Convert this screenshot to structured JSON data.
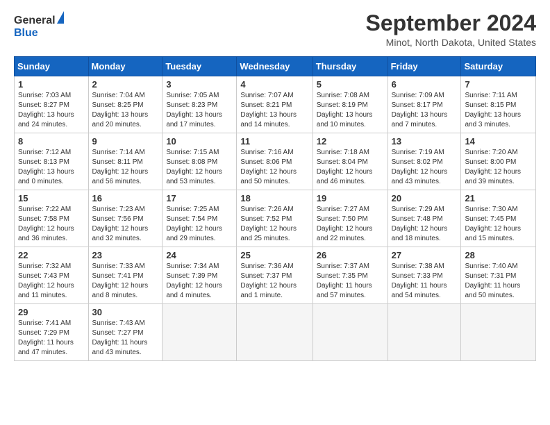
{
  "header": {
    "logo_general": "General",
    "logo_blue": "Blue",
    "month_title": "September 2024",
    "location": "Minot, North Dakota, United States"
  },
  "calendar": {
    "days_of_week": [
      "Sunday",
      "Monday",
      "Tuesday",
      "Wednesday",
      "Thursday",
      "Friday",
      "Saturday"
    ],
    "weeks": [
      [
        {
          "day": "",
          "empty": true
        },
        {
          "day": "",
          "empty": true
        },
        {
          "day": "",
          "empty": true
        },
        {
          "day": "",
          "empty": true
        },
        {
          "day": "",
          "empty": true
        },
        {
          "day": "",
          "empty": true
        },
        {
          "day": "",
          "empty": true
        }
      ]
    ]
  },
  "cells": {
    "empty": "",
    "w1": [
      {
        "num": "1",
        "sunrise": "Sunrise: 7:03 AM",
        "sunset": "Sunset: 8:27 PM",
        "daylight": "Daylight: 13 hours",
        "daylight2": "and 24 minutes."
      },
      {
        "num": "2",
        "sunrise": "Sunrise: 7:04 AM",
        "sunset": "Sunset: 8:25 PM",
        "daylight": "Daylight: 13 hours",
        "daylight2": "and 20 minutes."
      },
      {
        "num": "3",
        "sunrise": "Sunrise: 7:05 AM",
        "sunset": "Sunset: 8:23 PM",
        "daylight": "Daylight: 13 hours",
        "daylight2": "and 17 minutes."
      },
      {
        "num": "4",
        "sunrise": "Sunrise: 7:07 AM",
        "sunset": "Sunset: 8:21 PM",
        "daylight": "Daylight: 13 hours",
        "daylight2": "and 14 minutes."
      },
      {
        "num": "5",
        "sunrise": "Sunrise: 7:08 AM",
        "sunset": "Sunset: 8:19 PM",
        "daylight": "Daylight: 13 hours",
        "daylight2": "and 10 minutes."
      },
      {
        "num": "6",
        "sunrise": "Sunrise: 7:09 AM",
        "sunset": "Sunset: 8:17 PM",
        "daylight": "Daylight: 13 hours",
        "daylight2": "and 7 minutes."
      },
      {
        "num": "7",
        "sunrise": "Sunrise: 7:11 AM",
        "sunset": "Sunset: 8:15 PM",
        "daylight": "Daylight: 13 hours",
        "daylight2": "and 3 minutes."
      }
    ],
    "w2": [
      {
        "num": "8",
        "sunrise": "Sunrise: 7:12 AM",
        "sunset": "Sunset: 8:13 PM",
        "daylight": "Daylight: 13 hours",
        "daylight2": "and 0 minutes."
      },
      {
        "num": "9",
        "sunrise": "Sunrise: 7:14 AM",
        "sunset": "Sunset: 8:11 PM",
        "daylight": "Daylight: 12 hours",
        "daylight2": "and 56 minutes."
      },
      {
        "num": "10",
        "sunrise": "Sunrise: 7:15 AM",
        "sunset": "Sunset: 8:08 PM",
        "daylight": "Daylight: 12 hours",
        "daylight2": "and 53 minutes."
      },
      {
        "num": "11",
        "sunrise": "Sunrise: 7:16 AM",
        "sunset": "Sunset: 8:06 PM",
        "daylight": "Daylight: 12 hours",
        "daylight2": "and 50 minutes."
      },
      {
        "num": "12",
        "sunrise": "Sunrise: 7:18 AM",
        "sunset": "Sunset: 8:04 PM",
        "daylight": "Daylight: 12 hours",
        "daylight2": "and 46 minutes."
      },
      {
        "num": "13",
        "sunrise": "Sunrise: 7:19 AM",
        "sunset": "Sunset: 8:02 PM",
        "daylight": "Daylight: 12 hours",
        "daylight2": "and 43 minutes."
      },
      {
        "num": "14",
        "sunrise": "Sunrise: 7:20 AM",
        "sunset": "Sunset: 8:00 PM",
        "daylight": "Daylight: 12 hours",
        "daylight2": "and 39 minutes."
      }
    ],
    "w3": [
      {
        "num": "15",
        "sunrise": "Sunrise: 7:22 AM",
        "sunset": "Sunset: 7:58 PM",
        "daylight": "Daylight: 12 hours",
        "daylight2": "and 36 minutes."
      },
      {
        "num": "16",
        "sunrise": "Sunrise: 7:23 AM",
        "sunset": "Sunset: 7:56 PM",
        "daylight": "Daylight: 12 hours",
        "daylight2": "and 32 minutes."
      },
      {
        "num": "17",
        "sunrise": "Sunrise: 7:25 AM",
        "sunset": "Sunset: 7:54 PM",
        "daylight": "Daylight: 12 hours",
        "daylight2": "and 29 minutes."
      },
      {
        "num": "18",
        "sunrise": "Sunrise: 7:26 AM",
        "sunset": "Sunset: 7:52 PM",
        "daylight": "Daylight: 12 hours",
        "daylight2": "and 25 minutes."
      },
      {
        "num": "19",
        "sunrise": "Sunrise: 7:27 AM",
        "sunset": "Sunset: 7:50 PM",
        "daylight": "Daylight: 12 hours",
        "daylight2": "and 22 minutes."
      },
      {
        "num": "20",
        "sunrise": "Sunrise: 7:29 AM",
        "sunset": "Sunset: 7:48 PM",
        "daylight": "Daylight: 12 hours",
        "daylight2": "and 18 minutes."
      },
      {
        "num": "21",
        "sunrise": "Sunrise: 7:30 AM",
        "sunset": "Sunset: 7:45 PM",
        "daylight": "Daylight: 12 hours",
        "daylight2": "and 15 minutes."
      }
    ],
    "w4": [
      {
        "num": "22",
        "sunrise": "Sunrise: 7:32 AM",
        "sunset": "Sunset: 7:43 PM",
        "daylight": "Daylight: 12 hours",
        "daylight2": "and 11 minutes."
      },
      {
        "num": "23",
        "sunrise": "Sunrise: 7:33 AM",
        "sunset": "Sunset: 7:41 PM",
        "daylight": "Daylight: 12 hours",
        "daylight2": "and 8 minutes."
      },
      {
        "num": "24",
        "sunrise": "Sunrise: 7:34 AM",
        "sunset": "Sunset: 7:39 PM",
        "daylight": "Daylight: 12 hours",
        "daylight2": "and 4 minutes."
      },
      {
        "num": "25",
        "sunrise": "Sunrise: 7:36 AM",
        "sunset": "Sunset: 7:37 PM",
        "daylight": "Daylight: 12 hours",
        "daylight2": "and 1 minute."
      },
      {
        "num": "26",
        "sunrise": "Sunrise: 7:37 AM",
        "sunset": "Sunset: 7:35 PM",
        "daylight": "Daylight: 11 hours",
        "daylight2": "and 57 minutes."
      },
      {
        "num": "27",
        "sunrise": "Sunrise: 7:38 AM",
        "sunset": "Sunset: 7:33 PM",
        "daylight": "Daylight: 11 hours",
        "daylight2": "and 54 minutes."
      },
      {
        "num": "28",
        "sunrise": "Sunrise: 7:40 AM",
        "sunset": "Sunset: 7:31 PM",
        "daylight": "Daylight: 11 hours",
        "daylight2": "and 50 minutes."
      }
    ],
    "w5": [
      {
        "num": "29",
        "sunrise": "Sunrise: 7:41 AM",
        "sunset": "Sunset: 7:29 PM",
        "daylight": "Daylight: 11 hours",
        "daylight2": "and 47 minutes."
      },
      {
        "num": "30",
        "sunrise": "Sunrise: 7:43 AM",
        "sunset": "Sunset: 7:27 PM",
        "daylight": "Daylight: 11 hours",
        "daylight2": "and 43 minutes."
      },
      {
        "num": "",
        "empty": true
      },
      {
        "num": "",
        "empty": true
      },
      {
        "num": "",
        "empty": true
      },
      {
        "num": "",
        "empty": true
      },
      {
        "num": "",
        "empty": true
      }
    ]
  }
}
